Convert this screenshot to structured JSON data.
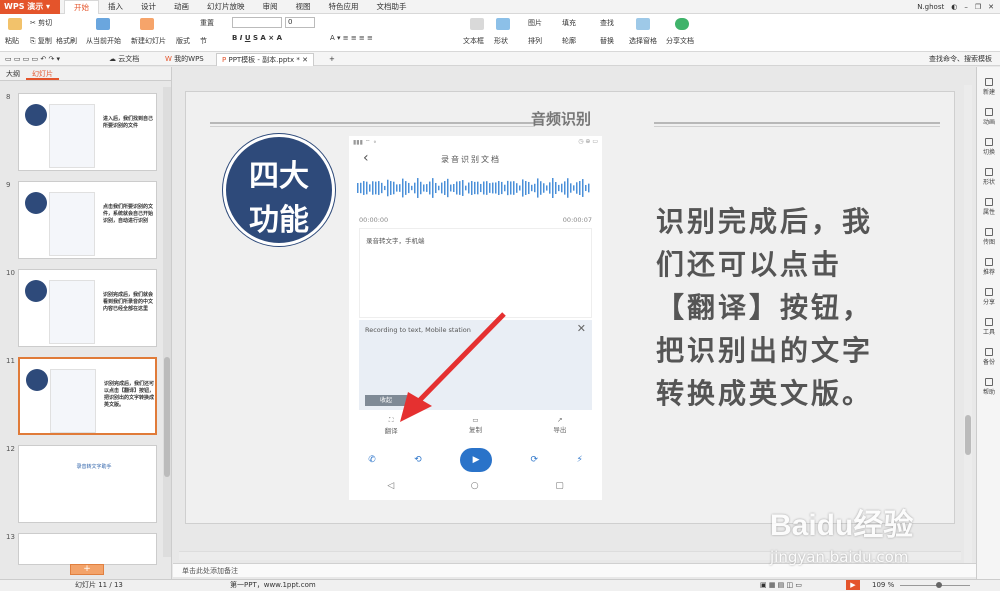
{
  "app": {
    "name": "WPS 演示",
    "user": "N.ghost"
  },
  "menu_tabs": [
    "开始",
    "插入",
    "设计",
    "动画",
    "幻灯片放映",
    "审阅",
    "视图",
    "特色应用",
    "文档助手"
  ],
  "ribbon": {
    "paste": "粘贴",
    "cut": "剪切",
    "copy": "复制",
    "format_painter": "格式刷",
    "from_current": "从当前开始",
    "new_slide": "新建幻灯片",
    "layout": "版式",
    "section": "节",
    "reset": "重置",
    "font_size": "0",
    "text_box": "文本框",
    "shape": "形状",
    "arrange": "排列",
    "picture": "图片",
    "fill": "填充",
    "outline": "轮廓",
    "find": "查找",
    "replace": "替换",
    "select_pane": "选择窗格",
    "share_doc": "分享文档"
  },
  "quickbar": {
    "cloud": "云文档",
    "my_wps": "我的WPS",
    "doc_tab": "PPT模板 - 副本.pptx *",
    "search": "查找命令、搜索模板"
  },
  "left_panel": {
    "tab_outline": "大纲",
    "tab_slides": "幻灯片",
    "slides": [
      {
        "num": "8",
        "text": "进入后，我们找到自己所要识别的文件"
      },
      {
        "num": "9",
        "text": "点击我们所要识别的文件，系统就会自己开始识别，自动进行识别"
      },
      {
        "num": "10",
        "text": "识别完成后，我们就会看到我们所录音的中文内容已经全部在这里"
      },
      {
        "num": "11",
        "text": "识别完成后，我们还可以点击【翻译】按钮，把识别出的文字转换成英文版。"
      },
      {
        "num": "12",
        "text": "录音转文字助手"
      },
      {
        "num": "13",
        "text": ""
      }
    ],
    "add_label": "+"
  },
  "slide": {
    "title": "音频识别",
    "badge": [
      "四大",
      "功能"
    ],
    "body_lines": [
      "识别完成后，我",
      "们还可以点击",
      "【翻译】按钮，",
      "把识别出的文字",
      "转换成英文版。"
    ],
    "phone": {
      "header": "录音识别文档",
      "time_start": "00:00:00",
      "time_end": "00:00:07",
      "transcript": "录音转文字，手机端",
      "translation": "Recording to text, Mobile station",
      "translate_btn": "翻译",
      "copy_btn": "复制",
      "export_btn": "导出",
      "hide_btn": "收起"
    }
  },
  "notes_placeholder": "单击此处添加备注",
  "status": {
    "slide_count": "幻灯片 11 / 13",
    "template": "第一PPT，www.1ppt.com",
    "zoom": "109 %"
  },
  "sidebar_items": [
    "新建",
    "动画",
    "切换",
    "形状",
    "属性",
    "传图",
    "推荐",
    "分享",
    "工具",
    "备份",
    "帮助"
  ],
  "watermark": {
    "brand": "Baidu经验",
    "url": "jingyan.baidu.com"
  },
  "colors": {
    "accent": "#e4542b",
    "badge": "#2e4a7a",
    "arrow": "#e53030"
  }
}
